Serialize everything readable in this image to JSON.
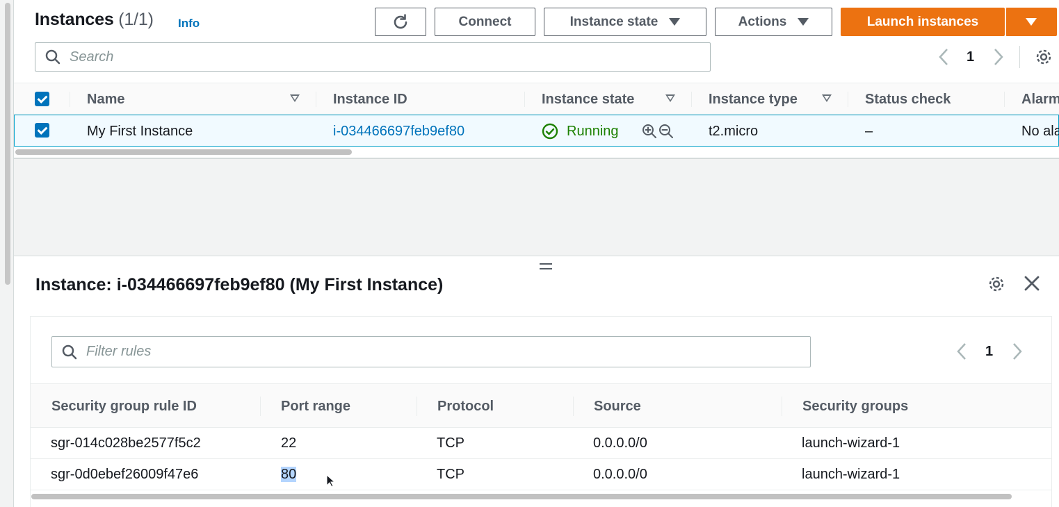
{
  "instances": {
    "title": "Instances",
    "count": "(1/1)",
    "info": "Info",
    "buttons": {
      "connect": "Connect",
      "instance_state": "Instance state",
      "actions": "Actions",
      "launch": "Launch instances"
    },
    "search_placeholder": "Search",
    "page": "1",
    "columns": [
      "Name",
      "Instance ID",
      "Instance state",
      "Instance type",
      "Status check",
      "Alarm"
    ],
    "row": {
      "name": "My First Instance",
      "id": "i-034466697feb9ef80",
      "state": "Running",
      "type": "t2.micro",
      "status_check": "–",
      "alarm": "No ala"
    }
  },
  "details": {
    "title": "Instance: i-034466697feb9ef80 (My First Instance)",
    "filter_placeholder": "Filter rules",
    "page": "1",
    "columns": [
      "Security group rule ID",
      "Port range",
      "Protocol",
      "Source",
      "Security groups"
    ],
    "rules": [
      {
        "id": "sgr-014c028be2577f5c2",
        "port": "22",
        "protocol": "TCP",
        "source": "0.0.0.0/0",
        "group": "launch-wizard-1"
      },
      {
        "id": "sgr-0d0ebef26009f47e6",
        "port": "80",
        "protocol": "TCP",
        "source": "0.0.0.0/0",
        "group": "launch-wizard-1"
      }
    ]
  },
  "colors": {
    "primary": "#ec7211",
    "link": "#0073bb",
    "running": "#1d8102",
    "selection_bg": "#f1faff"
  }
}
